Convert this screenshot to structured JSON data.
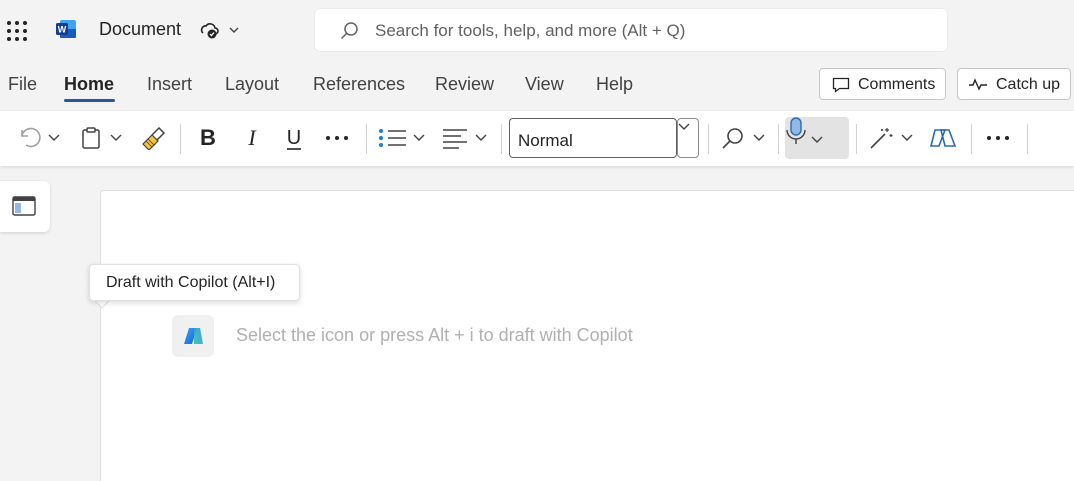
{
  "app": {
    "doc_title": "Document",
    "search_placeholder": "Search for tools, help, and more (Alt + Q)"
  },
  "menu": {
    "items": [
      "File",
      "Home",
      "Insert",
      "Layout",
      "References",
      "Review",
      "View",
      "Help"
    ],
    "active": "Home",
    "comments_label": "Comments",
    "catchup_label": "Catch up"
  },
  "ribbon": {
    "style_value": "Normal"
  },
  "copilot": {
    "tooltip": "Draft with Copilot (Alt+I)",
    "hint": "Select the icon or press Alt + i to draft with Copilot"
  },
  "colors": {
    "accent": "#2b579a",
    "word_blue": "#185abd"
  }
}
